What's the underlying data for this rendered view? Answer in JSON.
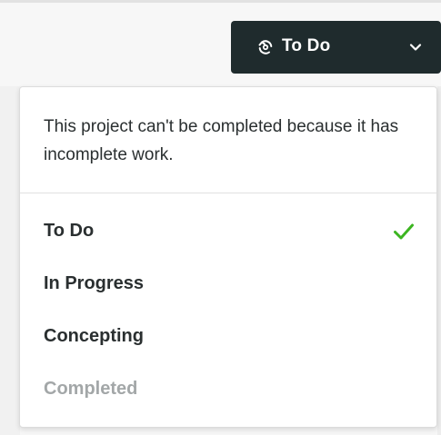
{
  "header": {
    "status_button": {
      "icon": "cycle-icon",
      "label": "To Do",
      "chevron": "chevron-down-icon"
    }
  },
  "dropdown": {
    "notice": "This project can't be completed because it has incomplete work.",
    "options": [
      {
        "label": "To Do",
        "selected": true,
        "disabled": false
      },
      {
        "label": "In Progress",
        "selected": false,
        "disabled": false
      },
      {
        "label": "Concepting",
        "selected": false,
        "disabled": false
      },
      {
        "label": "Completed",
        "selected": false,
        "disabled": true
      }
    ],
    "check_icon": "check-icon"
  },
  "colors": {
    "button_bg": "#1f2b2d",
    "check": "#3cb521",
    "text": "#2a2f30",
    "disabled_text": "#a3a7a8"
  }
}
